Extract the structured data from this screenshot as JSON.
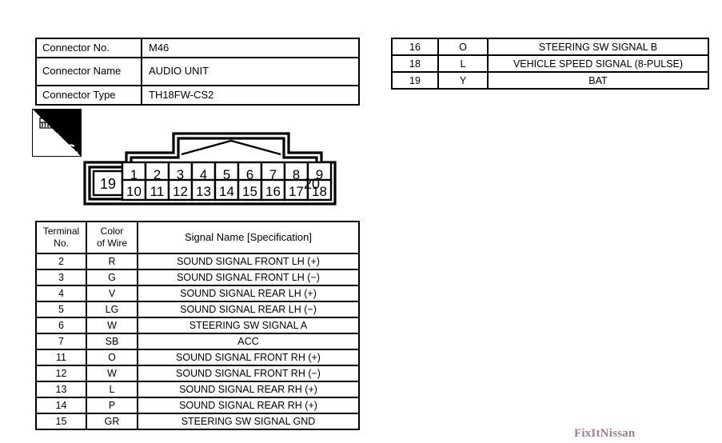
{
  "connector_info": {
    "rows": [
      {
        "label": "Connector No.",
        "value": "M46"
      },
      {
        "label": "Connector Name",
        "value": "AUDIO UNIT"
      },
      {
        "label": "Connector Type",
        "value": "TH18FW-CS2"
      }
    ]
  },
  "top_right_table": {
    "rows": [
      {
        "no": "16",
        "color": "O",
        "signal": "STEERING SW SIGNAL B"
      },
      {
        "no": "18",
        "color": "L",
        "signal": "VEHICLE SPEED SIGNAL (8-PULSE)"
      },
      {
        "no": "19",
        "color": "Y",
        "signal": "BAT"
      }
    ]
  },
  "hs_icon": {
    "label": "H.S.",
    "icon_name": "connector-housing-icon"
  },
  "pin_diagram": {
    "top_row": [
      "1",
      "2",
      "3",
      "4",
      "5",
      "6",
      "7",
      "8",
      "9"
    ],
    "bottom_row": [
      "10",
      "11",
      "12",
      "13",
      "14",
      "15",
      "16",
      "17",
      "18"
    ],
    "left_pin": "19",
    "right_pin": "20"
  },
  "terminal_table": {
    "headers": {
      "no_line1": "Terminal",
      "no_line2": "No.",
      "color_line1": "Color",
      "color_line2": "of Wire",
      "signal": "Signal Name [Specification]"
    },
    "rows": [
      {
        "no": "2",
        "color": "R",
        "signal": "SOUND SIGNAL FRONT LH (+)"
      },
      {
        "no": "3",
        "color": "G",
        "signal": "SOUND SIGNAL FRONT LH (−)"
      },
      {
        "no": "4",
        "color": "V",
        "signal": "SOUND SIGNAL REAR LH (+)"
      },
      {
        "no": "5",
        "color": "LG",
        "signal": "SOUND SIGNAL REAR LH (−)"
      },
      {
        "no": "6",
        "color": "W",
        "signal": "STEERING SW SIGNAL A"
      },
      {
        "no": "7",
        "color": "SB",
        "signal": "ACC"
      },
      {
        "no": "11",
        "color": "O",
        "signal": "SOUND SIGNAL FRONT RH (+)"
      },
      {
        "no": "12",
        "color": "W",
        "signal": "SOUND SIGNAL FRONT RH (−)"
      },
      {
        "no": "13",
        "color": "L",
        "signal": "SOUND SIGNAL REAR RH (+)"
      },
      {
        "no": "14",
        "color": "P",
        "signal": "SOUND SIGNAL REAR RH (+)"
      },
      {
        "no": "15",
        "color": "GR",
        "signal": "STEERING SW SIGNAL GND"
      }
    ]
  },
  "watermark": {
    "text": "FixItNissan"
  },
  "colors": {
    "line": "#000000",
    "background": "#ffffff",
    "watermark": "#4a1535"
  }
}
